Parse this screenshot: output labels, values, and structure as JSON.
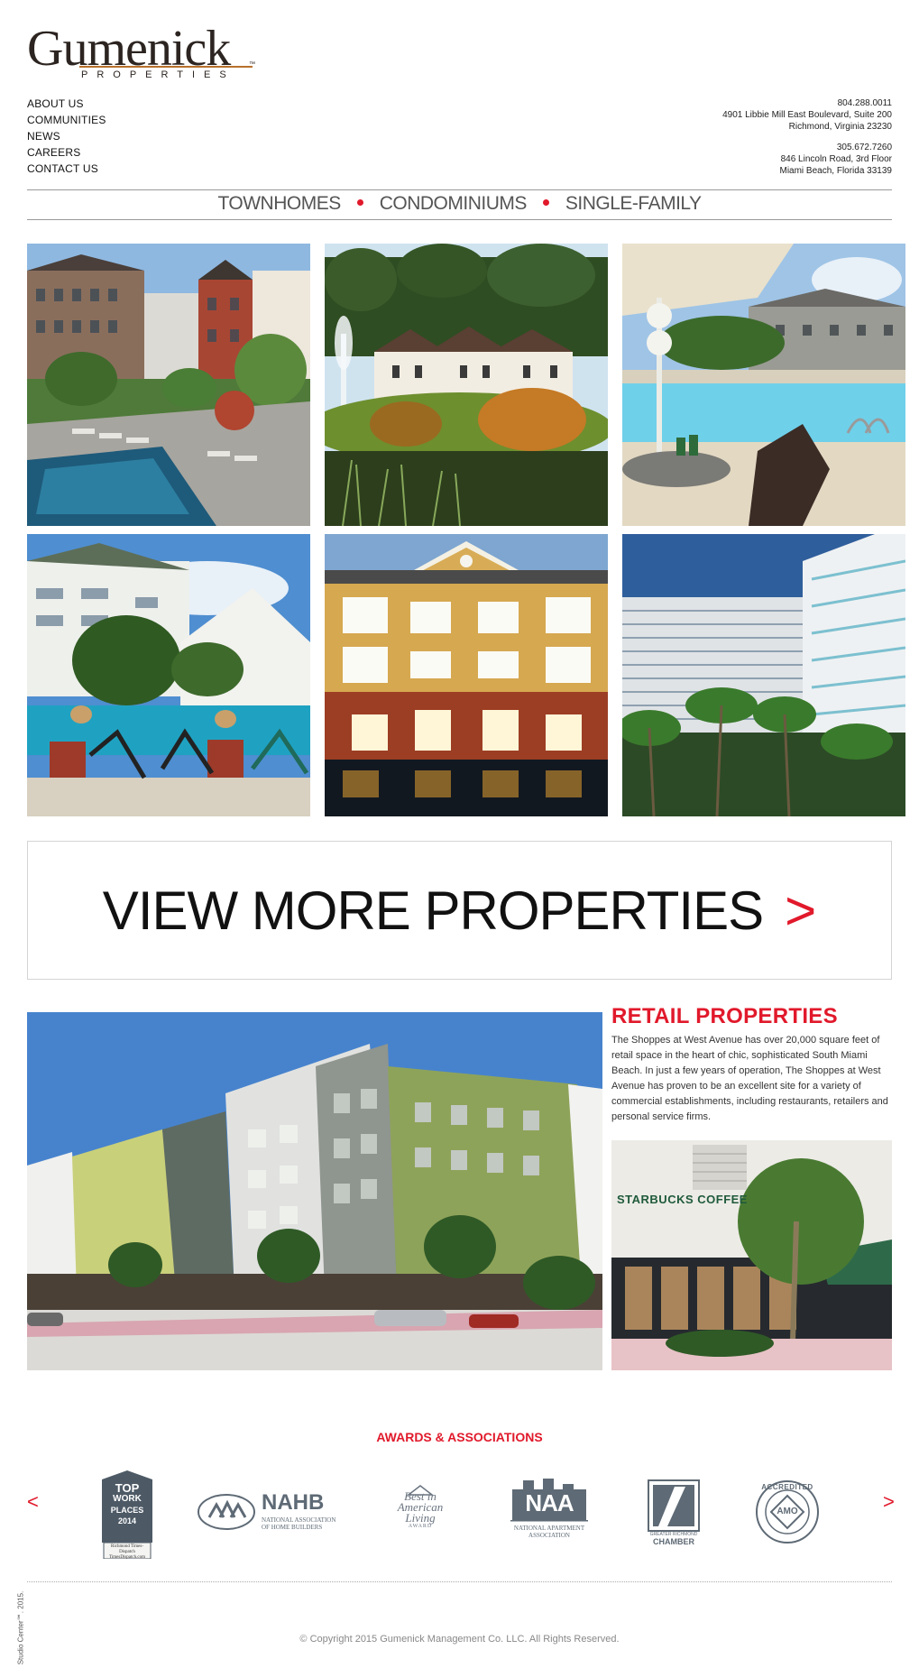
{
  "brand": {
    "name": "Gumenick",
    "sub": "PROPERTIES",
    "tm": "™"
  },
  "nav": {
    "items": [
      {
        "label": "ABOUT US"
      },
      {
        "label": "COMMUNITIES"
      },
      {
        "label": "NEWS"
      },
      {
        "label": "CAREERS"
      },
      {
        "label": "CONTACT US"
      }
    ]
  },
  "contact": {
    "richmond": {
      "phone": "804.288.0011",
      "street": "4901 Libbie Mill East Boulevard, Suite 200",
      "city": "Richmond, Virginia 23230"
    },
    "miami": {
      "phone": "305.672.7260",
      "street": "846 Lincoln Road, 3rd Floor",
      "city": "Miami Beach, Florida 33139"
    }
  },
  "types": {
    "townhomes": "TOWNHOMES",
    "condos": "CONDOMINIUMS",
    "single": "SINGLE-FAMILY"
  },
  "view_more": {
    "label": "VIEW MORE PROPERTIES",
    "arrow": ">"
  },
  "retail": {
    "title": "RETAIL PROPERTIES",
    "text": "The Shoppes at West Avenue has over 20,000 square feet of retail space in the heart of chic, sophisticated South Miami Beach. In just a few years of operation, The Shoppes at West Avenue has proven to be an excellent site for a variety of commercial establishments, including restaurants, retailers and personal service firms.",
    "storefront_sign": "STARBUCKS COFFEE"
  },
  "awards": {
    "title": "AWARDS & ASSOCIATIONS",
    "prev": "<",
    "next": ">",
    "top_work": {
      "line1": "TOP",
      "line2": "WORK",
      "line3": "PLACES",
      "year": "2014",
      "paper": "Richmond Times-Dispatch",
      "site": "TimesDispatch.com"
    },
    "nahb": {
      "abbr": "NAHB",
      "line1": "NATIONAL ASSOCIATION",
      "line2": "OF HOME BUILDERS"
    },
    "best": {
      "line1": "Best in",
      "line2": "American",
      "line3": "Living",
      "line4": "AWARD"
    },
    "naa": {
      "abbr": "NAA",
      "line1": "NATIONAL APARTMENT",
      "line2": "ASSOCIATION"
    },
    "chamber": {
      "line1": "GREATER RICHMOND",
      "line2": "CHAMBER"
    },
    "ams": {
      "top": "ACCREDITED",
      "center": "AMO"
    }
  },
  "footer": {
    "copyright": "© Copyright 2015 Gumenick Management Co. LLC. All Rights Reserved.",
    "credit": "Studio Center℠. 2015."
  },
  "colors": {
    "accent": "#e1192b",
    "brand_dark": "#2c2420",
    "brand_gold": "#b8712c"
  }
}
